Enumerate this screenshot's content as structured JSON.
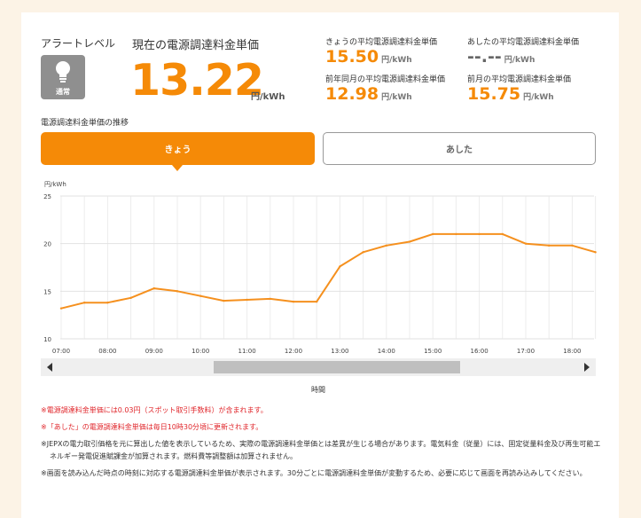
{
  "alert": {
    "label": "アラートレベル",
    "status": "通常",
    "icon": "lightbulb-icon"
  },
  "current": {
    "label": "現在の電源調達料金単価",
    "value": "13.22",
    "unit": "円/kWh"
  },
  "stats": [
    {
      "label": "きょうの平均電源調達料金単価",
      "value": "15.50",
      "unit": "円/kWh"
    },
    {
      "label": "あしたの平均電源調達料金単価",
      "value": "--.--",
      "unit": "円/kWh"
    },
    {
      "label": "前年同月の平均電源調達料金単価",
      "value": "12.98",
      "unit": "円/kWh"
    },
    {
      "label": "前月の平均電源調達料金単価",
      "value": "15.75",
      "unit": "円/kWh"
    }
  ],
  "trend_label": "電源調達料金単価の推移",
  "tabs": {
    "today": "きょう",
    "tomorrow": "あした"
  },
  "chart_data": {
    "type": "line",
    "ylabel": "円/kWh",
    "xlabel": "時間",
    "ylim": [
      10,
      25
    ],
    "yticks": [
      "10",
      "15",
      "20",
      "25"
    ],
    "xticks": [
      "07:00",
      "08:00",
      "09:00",
      "10:00",
      "11:00",
      "12:00",
      "13:00",
      "14:00",
      "15:00",
      "16:00",
      "17:00",
      "18:00"
    ],
    "x": [
      "07:00",
      "07:30",
      "08:00",
      "08:30",
      "09:00",
      "09:30",
      "10:00",
      "10:30",
      "11:00",
      "11:30",
      "12:00",
      "12:30",
      "13:00",
      "13:30",
      "14:00",
      "14:30",
      "15:00",
      "15:30",
      "16:00",
      "16:30",
      "17:00",
      "17:30",
      "18:00",
      "18:30"
    ],
    "series": [
      {
        "values": [
          13.2,
          13.8,
          13.8,
          14.3,
          15.3,
          15.0,
          14.5,
          14.0,
          14.1,
          14.2,
          13.9,
          13.9,
          17.6,
          19.1,
          19.8,
          20.2,
          21.0,
          21.0,
          21.0,
          21.0,
          20.0,
          19.8,
          19.8,
          19.1
        ]
      }
    ],
    "color": "#f5901e",
    "grid": true
  },
  "scrollbar": {
    "thumb_start": 0.3,
    "thumb_end": 0.77
  },
  "notes": [
    {
      "text": "※電源調達料金単価には0.03円（スポット取引手数料）が含まれます。",
      "type": "red"
    },
    {
      "text": "※「あした」の電源調達料金単価は毎日10時30分頃に更新されます。",
      "type": "red"
    },
    {
      "text": "※JEPXの電力取引価格を元に算出した値を表示しているため、実際の電源調達料金単価とは差異が生じる場合があります。電気料金（従量）には、固定従量料金及び再生可能エネルギー発電促進賦課金が加算されます。燃料費等調整額は加算されません。",
      "type": "gray"
    },
    {
      "text": "※画面を読み込んだ時点の時刻に対応する電源調達料金単価が表示されます。30分ごとに電源調達料金単価が変動するため、必要に応じて画面を再読み込みしてください。",
      "type": "gray"
    }
  ]
}
